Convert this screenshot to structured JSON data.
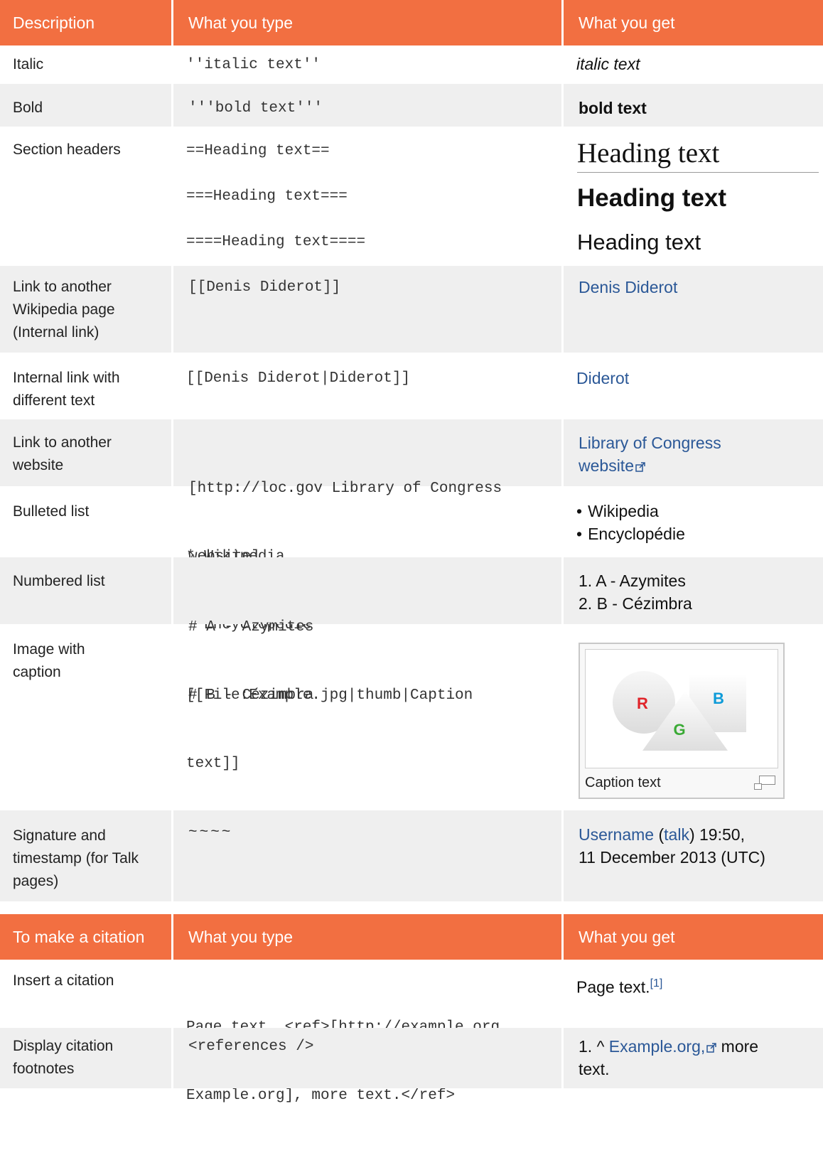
{
  "table1": {
    "headers": [
      "Description",
      "What you type",
      "What you get"
    ],
    "italic": {
      "desc": "Italic",
      "type": "''italic text''",
      "get": "italic text"
    },
    "bold": {
      "desc": "Bold",
      "type": "'''bold text'''",
      "get": "bold text"
    },
    "headers_row": {
      "desc": "Section headers",
      "type": [
        "==Heading text==",
        "===Heading text===",
        "====Heading text===="
      ],
      "get": [
        "Heading text",
        "Heading text",
        "Heading text"
      ]
    },
    "internal_link": {
      "desc": [
        "Link to another",
        "Wikipedia page",
        "(Internal link)"
      ],
      "type": "[[Denis Diderot]]",
      "get": "Denis Diderot"
    },
    "piped_link": {
      "desc": [
        "Internal link with",
        "different text"
      ],
      "type": "[[Denis Diderot|Diderot]]",
      "get": "Diderot"
    },
    "external_link": {
      "desc": [
        "Link to another",
        "website"
      ],
      "type": [
        "[http://loc.gov Library of Congress",
        "website]"
      ],
      "get": [
        "Library of Congress",
        "website"
      ]
    },
    "bulleted": {
      "desc": "Bulleted list",
      "type": [
        "* Wikipedia",
        "* Encyclopédie"
      ],
      "get": [
        "Wikipedia",
        "Encyclopédie"
      ]
    },
    "numbered": {
      "desc": "Numbered list",
      "type": [
        "# A - Azymites",
        "# B - Cézimbra"
      ],
      "get": [
        "1. A - Azymites",
        "2. B - Cézimbra"
      ]
    },
    "image": {
      "desc": [
        "Image with",
        "caption"
      ],
      "type": [
        "[[File:Example.jpg|thumb|Caption",
        "text]]"
      ],
      "letters": [
        "R",
        "G",
        "B"
      ],
      "letter_colors": [
        "#e0242a",
        "#3aaa35",
        "#0e9bd8"
      ],
      "caption": "Caption text",
      "icon": "enlarge-icon"
    },
    "signature": {
      "desc": [
        "Signature and",
        "timestamp (for Talk",
        "pages)"
      ],
      "type": "~~~~",
      "get_user": "Username",
      "get_talk": "talk",
      "get_rest1": ") 19:50,",
      "get_line2": "11 December 2013 (UTC)"
    }
  },
  "table2": {
    "headers": [
      "To make a citation",
      "What you type",
      "What you get"
    ],
    "insert": {
      "desc": "Insert a citation",
      "type": [
        "Page text. <ref>[http://example.org",
        "Example.org], more text.</ref>"
      ],
      "get": "Page text.",
      "sup": "[1]"
    },
    "display": {
      "desc": [
        "Display citation",
        "footnotes"
      ],
      "type": "<references />",
      "get_prefix": "1. ^ ",
      "get_link": "Example.org,",
      "get_suffix": " more",
      "get_line2": "text."
    }
  },
  "colors": {
    "header": "#f26f41",
    "row_alt": "#efefef",
    "link": "#2b5897"
  }
}
